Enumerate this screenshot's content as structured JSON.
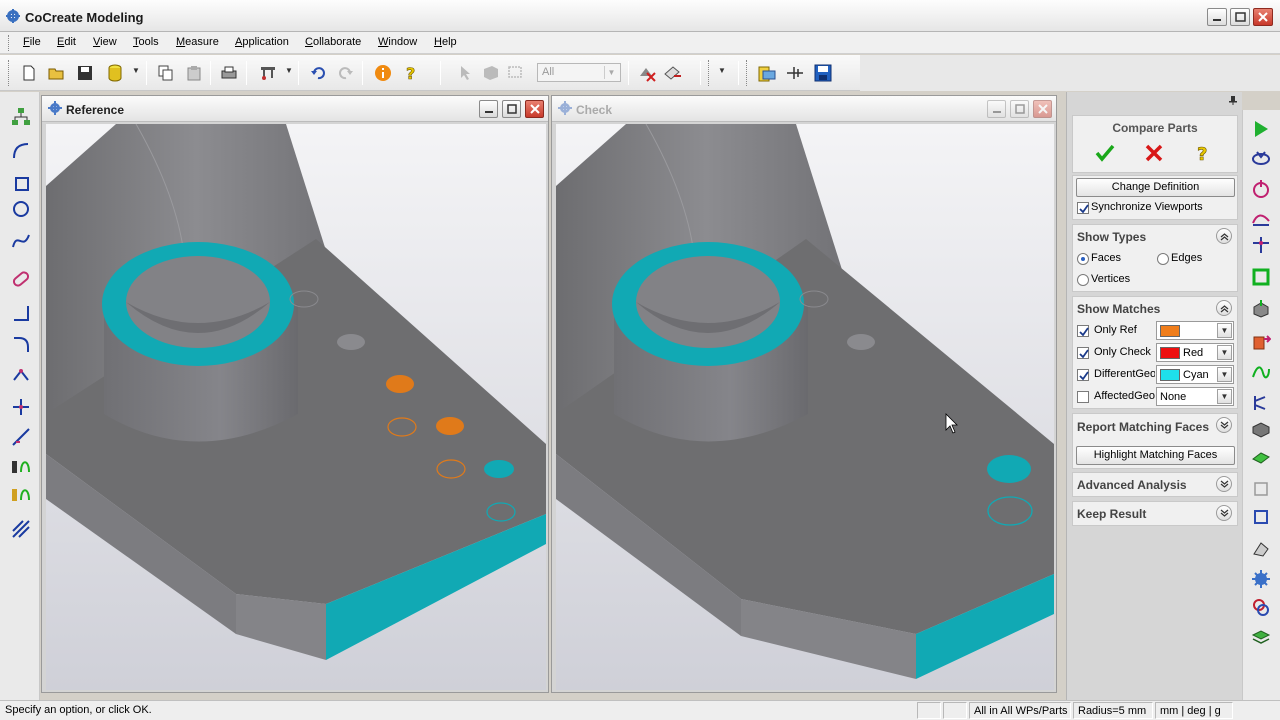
{
  "window": {
    "title": "CoCreate Modeling"
  },
  "menu": [
    "File",
    "Edit",
    "View",
    "Tools",
    "Measure",
    "Application",
    "Collaborate",
    "Window",
    "Help"
  ],
  "toolbar": {
    "filter_value": "All"
  },
  "viewports": {
    "reference": {
      "title": "Reference"
    },
    "check": {
      "title": "Check"
    }
  },
  "panel": {
    "title": "Compare Parts",
    "change_definition": "Change Definition",
    "sync_viewports": "Synchronize Viewports",
    "show_types": {
      "header": "Show Types",
      "faces": "Faces",
      "edges": "Edges",
      "vertices": "Vertices"
    },
    "show_matches": {
      "header": "Show Matches",
      "rows": [
        {
          "label": "Only Ref",
          "checked": true,
          "color": "#f07d1a",
          "color_name": ""
        },
        {
          "label": "Only Check",
          "checked": true,
          "color": "#ee1010",
          "color_name": "Red"
        },
        {
          "label": "DifferentGeo",
          "checked": true,
          "color": "#1ee0ea",
          "color_name": "Cyan"
        },
        {
          "label": "AffectedGeo",
          "checked": false,
          "color": "",
          "color_name": "None"
        }
      ]
    },
    "report_matching_faces": "Report Matching Faces",
    "highlight_matching_faces": "Highlight Matching Faces",
    "advanced_analysis": "Advanced Analysis",
    "keep_result": "Keep Result"
  },
  "status": {
    "message": "Specify an option, or click OK.",
    "scope": "All in All WPs/Parts",
    "radius": "Radius=5 mm",
    "units": "mm | deg | g"
  },
  "colors": {
    "teal": "#11a9b4",
    "orange": "#e07a1a",
    "part_top": "#6e6e6e",
    "background": "#dcdde0"
  }
}
